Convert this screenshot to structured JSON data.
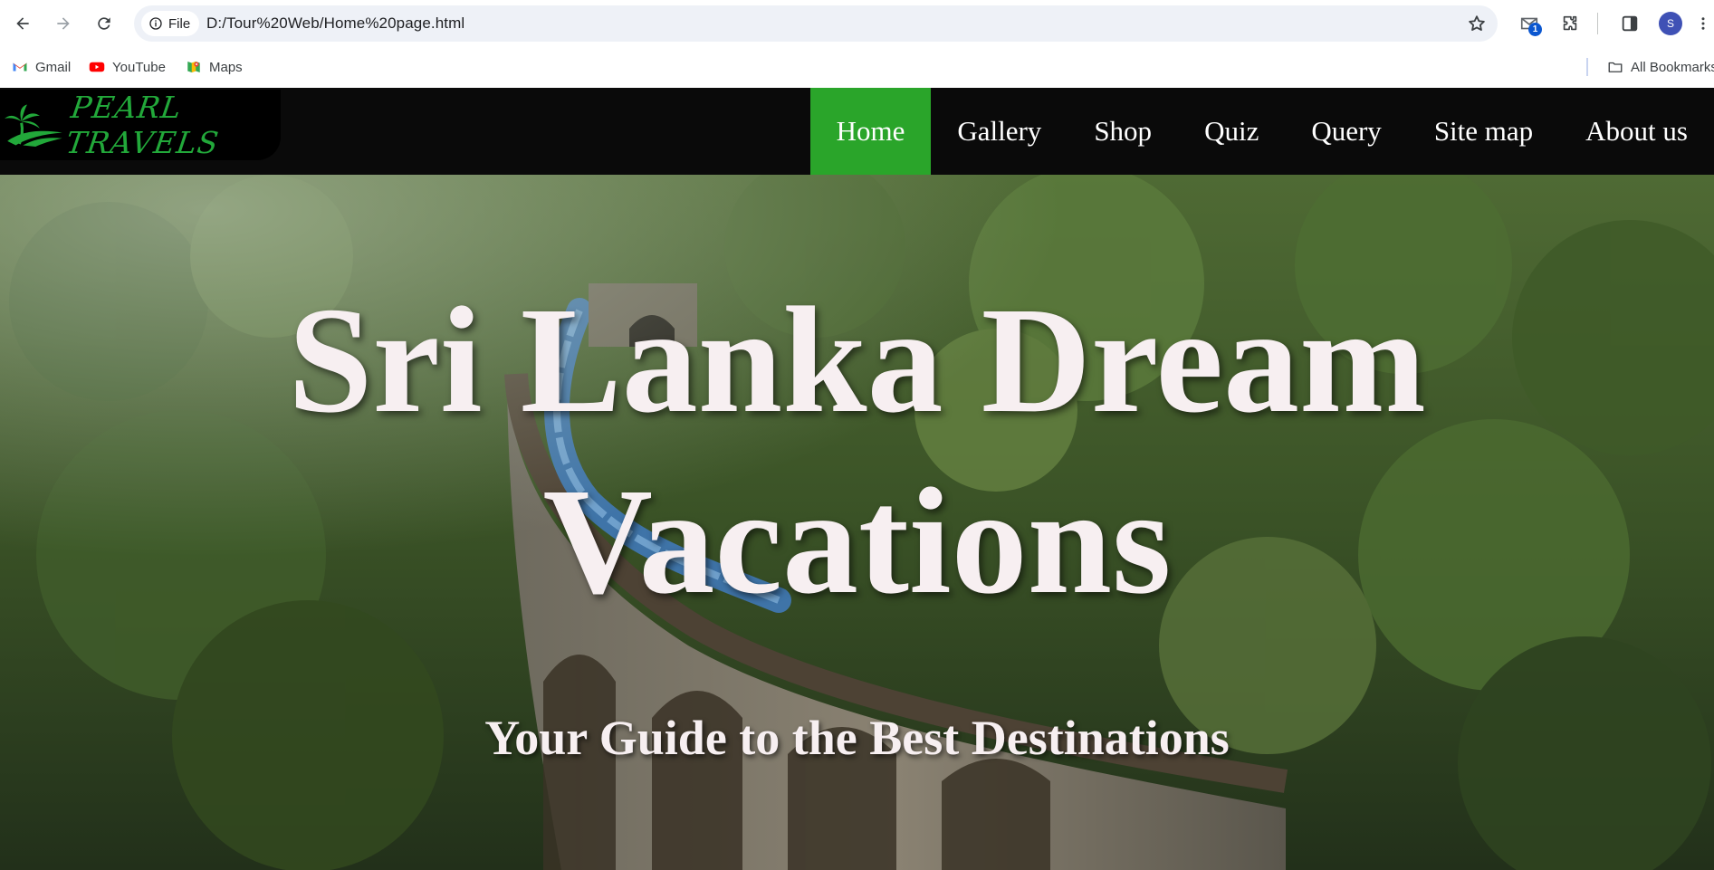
{
  "browser": {
    "site_chip_label": "File",
    "url": "D:/Tour%20Web/Home%20page.html",
    "extension_badge": "1",
    "profile_initial": "S",
    "bookmarks": [
      {
        "label": "Gmail",
        "icon": "gmail-icon"
      },
      {
        "label": "YouTube",
        "icon": "youtube-icon"
      },
      {
        "label": "Maps",
        "icon": "maps-icon"
      }
    ],
    "all_bookmarks_label": "All Bookmarks"
  },
  "site": {
    "logo_text": "PEARL TRAVELS",
    "accent_color": "#2aa52a",
    "nav": [
      {
        "label": "Home",
        "active": true
      },
      {
        "label": "Gallery",
        "active": false
      },
      {
        "label": "Shop",
        "active": false
      },
      {
        "label": "Quiz",
        "active": false
      },
      {
        "label": "Query",
        "active": false
      },
      {
        "label": "Site map",
        "active": false
      },
      {
        "label": "About us",
        "active": false
      }
    ]
  },
  "hero": {
    "title": "Sri Lanka Dream Vacations",
    "subtitle": "Your Guide to the Best Destinations"
  }
}
